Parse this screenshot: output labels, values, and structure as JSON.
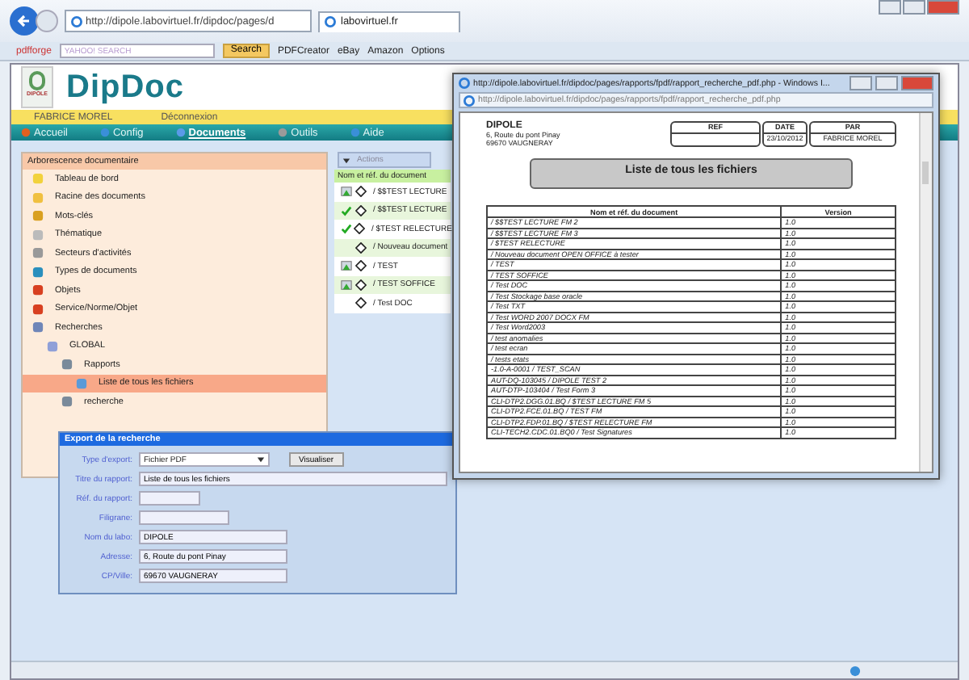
{
  "browser": {
    "address": "http://dipole.labovirtuel.fr/dipdoc/pages/d",
    "tab": "labovirtuel.fr",
    "toolbar": {
      "brand": "pdfforge",
      "search_placeholder": "YAHOO! SEARCH",
      "search_button": "Search",
      "links": [
        "PDFCreator",
        "eBay",
        "Amazon",
        "Options"
      ]
    }
  },
  "app": {
    "logo": "DipDoc",
    "logo_sub": "DIPOLE",
    "user": "FABRICE MOREL",
    "logout": "Déconnexion",
    "nav": [
      {
        "label": "Accueil",
        "selected": false
      },
      {
        "label": "Config",
        "selected": false
      },
      {
        "label": "Documents",
        "selected": true
      },
      {
        "label": "Outils",
        "selected": false
      },
      {
        "label": "Aide",
        "selected": false
      }
    ]
  },
  "tree": {
    "title": "Arborescence documentaire",
    "items": [
      {
        "label": "Tableau de bord",
        "selected": false
      },
      {
        "label": "Racine des documents",
        "selected": false
      },
      {
        "label": "Mots-clés",
        "selected": false
      },
      {
        "label": "Thématique",
        "selected": false
      },
      {
        "label": "Secteurs d'activités",
        "selected": false
      },
      {
        "label": "Types de documents",
        "selected": false
      },
      {
        "label": "Objets",
        "selected": false
      },
      {
        "label": "Service/Norme/Objet",
        "selected": false
      },
      {
        "label": "Recherches",
        "selected": false,
        "children": [
          {
            "label": "GLOBAL",
            "selected": false,
            "children": [
              {
                "label": "Rapports",
                "selected": false,
                "children": [
                  {
                    "label": "Liste de tous les fichiers",
                    "selected": true
                  }
                ]
              },
              {
                "label": "recherche",
                "selected": false
              }
            ]
          }
        ]
      }
    ]
  },
  "documents": {
    "actions": "Actions",
    "column": "Nom et réf. du document",
    "rows": [
      {
        "name": "/ $$TEST LECTURE",
        "kind": "pending"
      },
      {
        "name": "/ $$TEST LECTURE",
        "kind": "validated"
      },
      {
        "name": "/ $TEST RELECTURE",
        "kind": "validated"
      },
      {
        "name": "/ Nouveau document",
        "kind": "none"
      },
      {
        "name": "/ TEST",
        "kind": "pending"
      },
      {
        "name": "/ TEST SOFFICE",
        "kind": "pending"
      },
      {
        "name": "/ Test DOC",
        "kind": "none"
      }
    ]
  },
  "export": {
    "title": "Export de la recherche",
    "type_label": "Type d'export:",
    "type_value": "Fichier PDF",
    "preview_button": "Visualiser",
    "fields": [
      {
        "label": "Titre du rapport:",
        "value": "Liste de tous les fichiers",
        "kind": "wide"
      },
      {
        "label": "Réf. du rapport:",
        "kind": "short"
      },
      {
        "label": "Filigrane:",
        "kind": "medium"
      },
      {
        "label": "Nom du labo:",
        "value": "DIPOLE",
        "kind": "long"
      },
      {
        "label": "Adresse:",
        "value": "6, Route du pont Pinay",
        "kind": "long"
      },
      {
        "label": "CP/Ville:",
        "value": "69670 VAUGNERAY",
        "kind": "long"
      }
    ]
  },
  "popup": {
    "title": "http://dipole.labovirtuel.fr/dipdoc/pages/rapports/fpdf/rapport_recherche_pdf.php - Windows I...",
    "address": "http://dipole.labovirtuel.fr/dipdoc/pages/rapports/fpdf/rapport_recherche_pdf.php",
    "document": {
      "company": "DIPOLE",
      "address_lines": [
        "6, Route du pont Pinay",
        "69670 VAUGNERAY"
      ],
      "header": [
        {
          "label": "REF"
        },
        {
          "label": "DATE",
          "value": "23/10/2012"
        },
        {
          "label": "PAR",
          "value": "FABRICE MOREL"
        }
      ],
      "title": "Liste de tous les fichiers",
      "columns": [
        "Nom et réf. du document",
        "Version"
      ],
      "rows": [
        {
          "name": "/ $$TEST LECTURE FM 2",
          "version": "1.0"
        },
        {
          "name": "/ $$TEST LECTURE FM 3",
          "version": "1.0"
        },
        {
          "name": "/ $TEST RELECTURE",
          "version": "1.0"
        },
        {
          "name": "/ Nouveau document OPEN OFFICE à tester",
          "version": "1.0"
        },
        {
          "name": "/ TEST",
          "version": "1.0"
        },
        {
          "name": "/ TEST SOFFICE",
          "version": "1.0"
        },
        {
          "name": "/ Test DOC",
          "version": "1.0"
        },
        {
          "name": "/ Test Stockage base oracle",
          "version": "1.0"
        },
        {
          "name": "/ Test TXT",
          "version": "1.0"
        },
        {
          "name": "/ Test WORD 2007 DOCX FM",
          "version": "1.0"
        },
        {
          "name": "/ Test Word2003",
          "version": "1.0"
        },
        {
          "name": "/ test anomalies",
          "version": "1.0"
        },
        {
          "name": "/ test ecran",
          "version": "1.0"
        },
        {
          "name": "/ tests etats",
          "version": "1.0"
        },
        {
          "name": "-1.0-A-0001 / TEST_SCAN",
          "version": "1.0"
        },
        {
          "name": "AUT-DQ-103045 / DIPOLE TEST 2",
          "version": "1.0"
        },
        {
          "name": "AUT-DTP-103404 / Test Form 3",
          "version": "1.0"
        },
        {
          "name": "CLI-DTP2.DGG.01.BQ / $TEST LECTURE FM 5",
          "version": "1.0"
        },
        {
          "name": "CLI-DTP2.FCE.01.BQ / TEST FM",
          "version": "1.0"
        },
        {
          "name": "CLI-DTP2.FDP.01.BQ / $TEST RELECTURE FM",
          "version": "1.0"
        },
        {
          "name": "CLI-TECH2.CDC.01.BQ0 / Test Signatures",
          "version": "1.0"
        }
      ]
    }
  }
}
